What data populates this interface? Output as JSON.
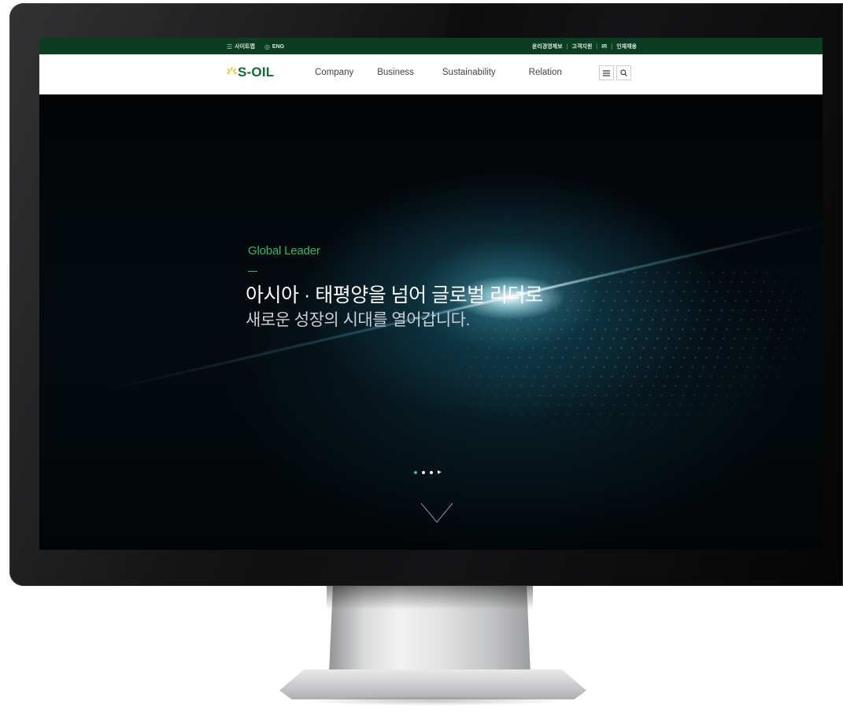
{
  "utility_bar": {
    "sitemap_label": "사이트맵",
    "language_label": "ENG",
    "links": [
      "윤리경영제보",
      "고객지원",
      "IR",
      "인재채용"
    ]
  },
  "brand": {
    "logo_text": "S-OIL",
    "color": "#0f6a36",
    "sun_color": "#f5b400"
  },
  "nav": {
    "items": [
      "Company",
      "Business",
      "Sustainability",
      "Relation"
    ]
  },
  "nav_buttons": {
    "menu_icon": "hamburger-icon",
    "search_icon": "search-icon"
  },
  "hero": {
    "eyebrow": "Global Leader",
    "headline": "아시아 · 태평양을 넘어 글로벌 리더로",
    "subheadline": "새로운 성장의 시대를 열어갑니다.",
    "accent_color": "#35b86a",
    "slides_total": 3,
    "active_slide": 1,
    "scroll_icon": "chevron-down-icon"
  }
}
